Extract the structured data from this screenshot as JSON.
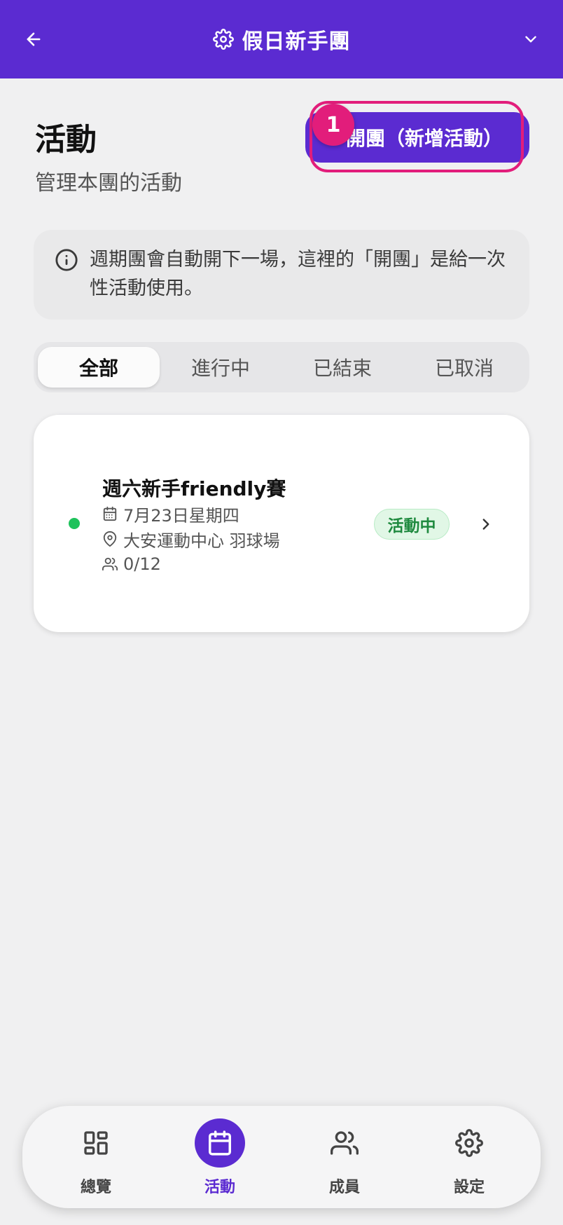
{
  "header": {
    "title": "假日新手團",
    "back_icon": "arrow-left-icon",
    "settings_icon": "gear-icon",
    "dropdown_icon": "chevron-down-icon",
    "background_color": "#5b2bd1"
  },
  "page": {
    "title": "活動",
    "subtitle": "管理本團的活動"
  },
  "create_button": {
    "label": "開團（新增活動）",
    "step_number": "1",
    "highlight_color": "#e21d7b"
  },
  "info": {
    "icon": "info-icon",
    "text": "週期團會自動開下一場，這裡的「開團」是給一次性活動使用。"
  },
  "filter_tabs": [
    {
      "label": "全部",
      "active": true
    },
    {
      "label": "進行中",
      "active": false
    },
    {
      "label": "已結束",
      "active": false
    },
    {
      "label": "已取消",
      "active": false
    }
  ],
  "activities": [
    {
      "name": "週六新手friendly賽",
      "date": "7月23日星期四",
      "location": "大安運動中心 羽球場",
      "participants": "0/12",
      "status": "活動中",
      "status_color": "#1ec25b"
    }
  ],
  "bottom_nav": [
    {
      "label": "總覽",
      "icon": "dashboard-grid-icon",
      "active": false
    },
    {
      "label": "活動",
      "icon": "calendar-icon",
      "active": true
    },
    {
      "label": "成員",
      "icon": "users-icon",
      "active": false
    },
    {
      "label": "設定",
      "icon": "gear-icon",
      "active": false
    }
  ]
}
